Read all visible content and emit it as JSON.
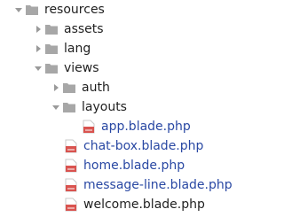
{
  "tree": {
    "resources": {
      "label": "resources"
    },
    "assets": {
      "label": "assets"
    },
    "lang": {
      "label": "lang"
    },
    "views": {
      "label": "views"
    },
    "auth": {
      "label": "auth"
    },
    "layouts": {
      "label": "layouts"
    },
    "app_blade": {
      "label": "app.blade.php"
    },
    "chat_box": {
      "label": "chat-box.blade.php"
    },
    "home": {
      "label": "home.blade.php"
    },
    "message_line": {
      "label": "message-line.blade.php"
    },
    "welcome": {
      "label": "welcome.blade.php"
    }
  },
  "colors": {
    "folder": "#a7a7a7",
    "arrow": "#9a9a9a",
    "file_text": "#2948a3",
    "folder_text": "#1f1f1f",
    "php_icon": "#d9534f"
  },
  "icons": {
    "expanded": "chevron-down-icon",
    "collapsed": "chevron-right-icon",
    "folder": "folder-icon",
    "file": "php-file-icon"
  }
}
